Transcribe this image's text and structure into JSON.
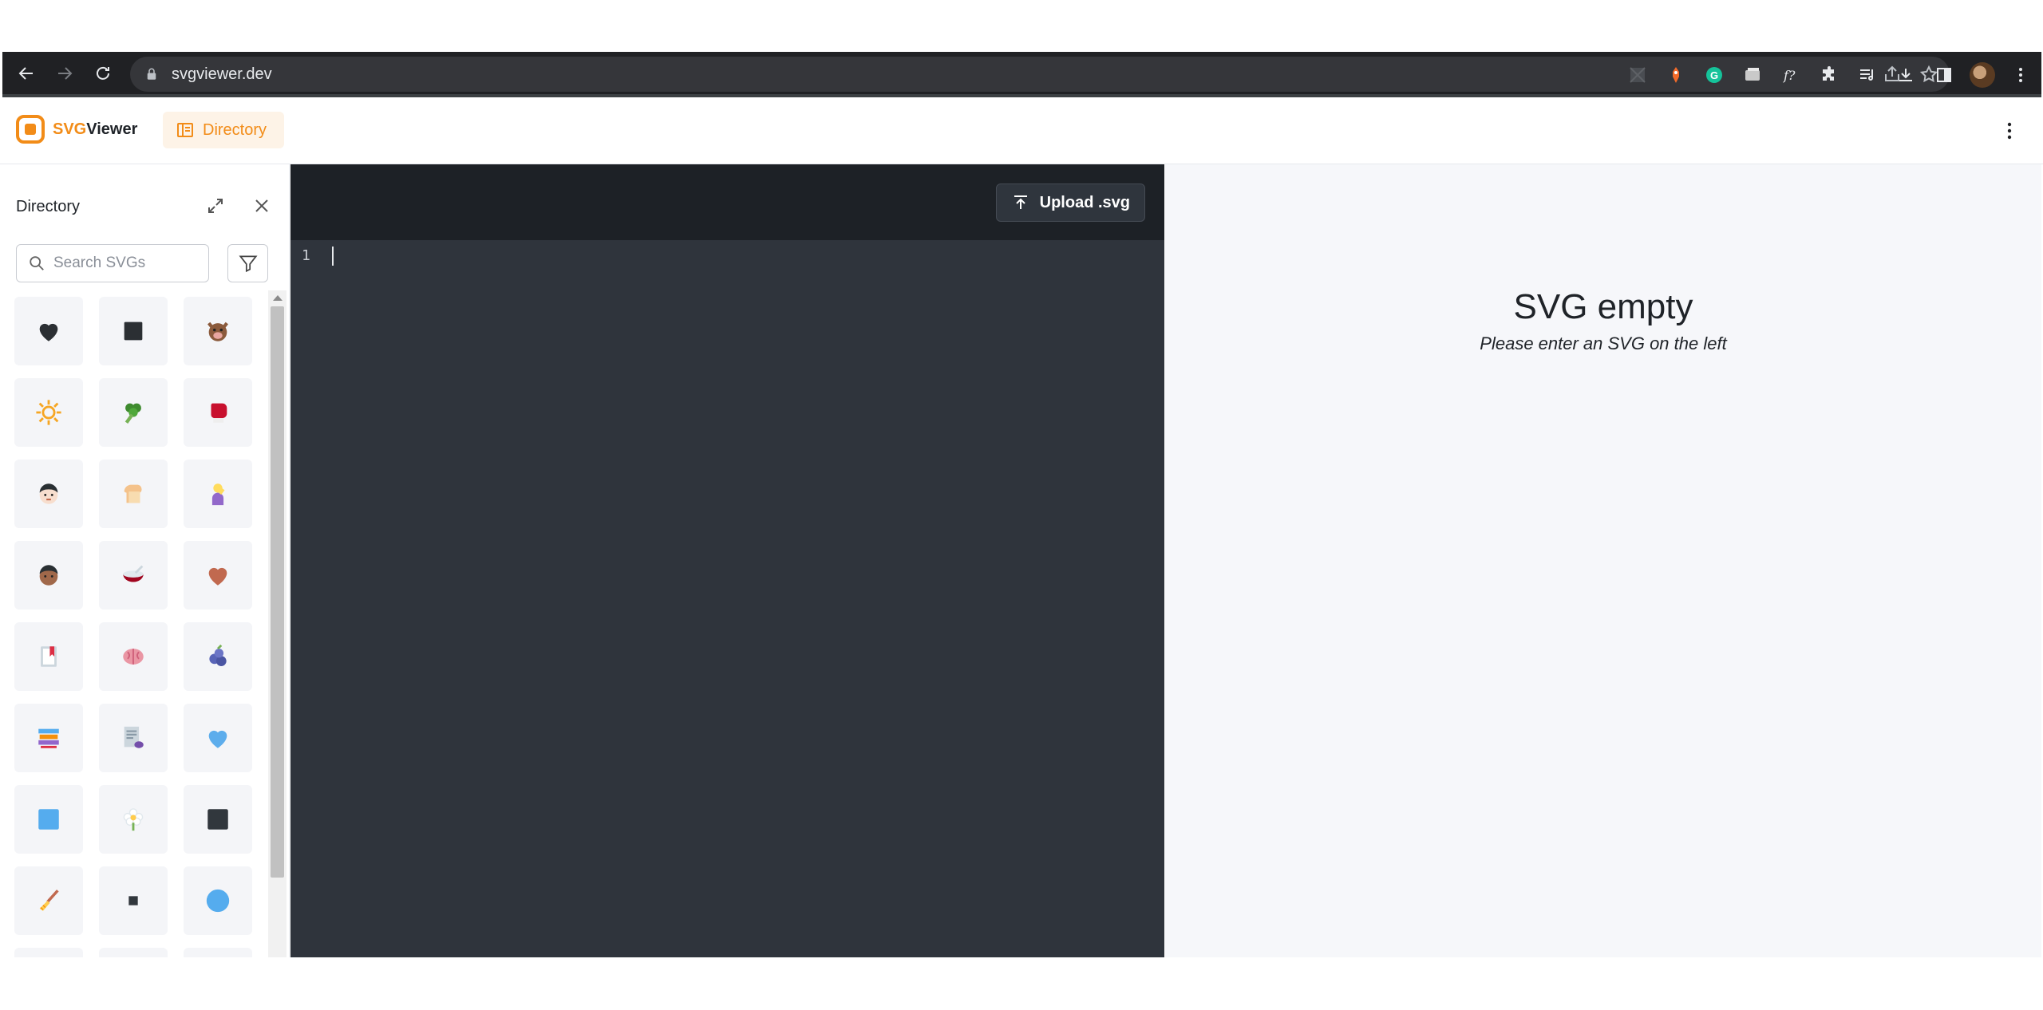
{
  "browser": {
    "url": "svgviewer.dev",
    "extensions": [
      "ext-blank-icon",
      "ext-fox-icon",
      "grammarly-icon",
      "ext-window-icon",
      "ext-formula-icon",
      "extensions-puzzle-icon",
      "reading-list-icon",
      "download-icon",
      "side-panel-icon",
      "profile-avatar"
    ]
  },
  "header": {
    "logo_prefix": "SVG",
    "logo_suffix": "Viewer",
    "directory_tab": "Directory"
  },
  "sidebar": {
    "title": "Directory",
    "search_placeholder": "Search SVGs",
    "icons": [
      {
        "name": "black-heart-icon"
      },
      {
        "name": "black-square-icon"
      },
      {
        "name": "boar-icon"
      },
      {
        "name": "sun-icon"
      },
      {
        "name": "broccoli-icon"
      },
      {
        "name": "boxing-glove-icon"
      },
      {
        "name": "boy-face-icon"
      },
      {
        "name": "bread-icon"
      },
      {
        "name": "person-gesture-icon"
      },
      {
        "name": "brown-face-icon"
      },
      {
        "name": "bowl-icon"
      },
      {
        "name": "brown-heart-icon"
      },
      {
        "name": "bookmark-icon"
      },
      {
        "name": "brain-icon"
      },
      {
        "name": "blueberries-icon"
      },
      {
        "name": "books-icon"
      },
      {
        "name": "document-icon"
      },
      {
        "name": "blue-heart-icon"
      },
      {
        "name": "blue-square-icon"
      },
      {
        "name": "blossom-icon"
      },
      {
        "name": "dark-square-icon"
      },
      {
        "name": "broom-icon"
      },
      {
        "name": "small-square-icon"
      },
      {
        "name": "blue-circle-icon"
      },
      {
        "name": "partial-icon-1"
      },
      {
        "name": "partial-icon-2"
      },
      {
        "name": "partial-icon-3"
      }
    ]
  },
  "editor": {
    "upload_label": "Upload .svg",
    "line_number": "1"
  },
  "preview": {
    "title": "SVG empty",
    "subtitle": "Please enter an SVG on the left"
  },
  "colors": {
    "accent": "#f28c18",
    "editor_bg": "#2f343c",
    "editor_toolbar_bg": "#1d2126",
    "preview_bg": "#f6f7fa"
  }
}
